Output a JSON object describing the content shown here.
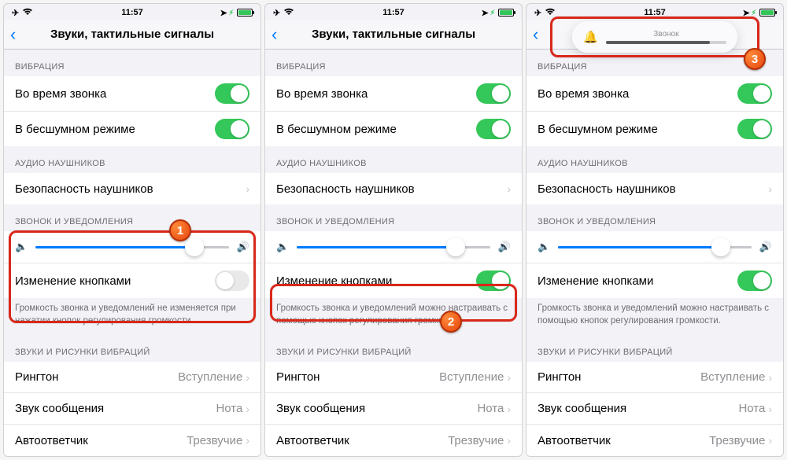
{
  "status": {
    "time": "11:57"
  },
  "nav": {
    "title": "Звуки, тактильные сигналы"
  },
  "sections": {
    "vibration": {
      "header": "ВИБРАЦИЯ",
      "ring": "Во время звонка",
      "silent": "В бесшумном режиме"
    },
    "headphones": {
      "header": "АУДИО НАУШНИКОВ",
      "safety": "Безопасность наушников"
    },
    "ringer": {
      "header": "ЗВОНОК И УВЕДОМЛЕНИЯ",
      "change_buttons": "Изменение кнопками",
      "footer_off": "Громкость звонка и уведомлений не изменяется при нажатии кнопок регулирования громкости.",
      "footer_on": "Громкость звонка и уведомлений можно настраивать с помощью кнопок регулирования громкости."
    },
    "sounds": {
      "header": "ЗВУКИ И РИСУНКИ ВИБРАЦИЙ",
      "ringtone": {
        "label": "Рингтон",
        "value": "Вступление"
      },
      "text": {
        "label": "Звук сообщения",
        "value": "Нота"
      },
      "voicemail": {
        "label": "Автоответчик",
        "value": "Трезвучие"
      }
    }
  },
  "hud": {
    "title": "Звонок"
  },
  "badges": {
    "b1": "1",
    "b2": "2",
    "b3": "3"
  }
}
